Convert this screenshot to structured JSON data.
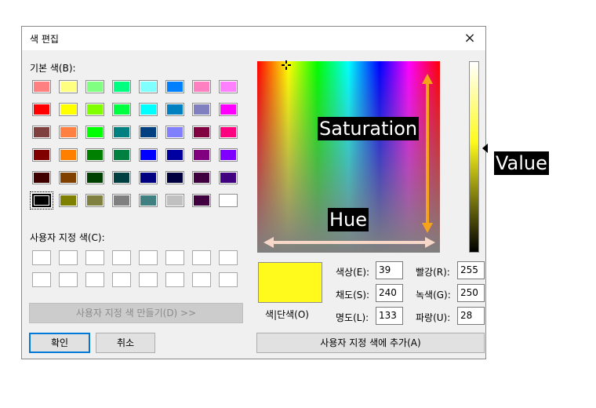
{
  "dialog": {
    "title": "색 편집",
    "close_icon": "×"
  },
  "basic_colors": {
    "label": "기본 색(B):",
    "rows": [
      [
        "#ff8080",
        "#ffff80",
        "#80ff80",
        "#00ff80",
        "#80ffff",
        "#0080ff",
        "#ff80c0",
        "#ff80ff"
      ],
      [
        "#ff0000",
        "#ffff00",
        "#80ff00",
        "#00ff40",
        "#00ffff",
        "#0080c0",
        "#8080c0",
        "#ff00ff"
      ],
      [
        "#804040",
        "#ff8040",
        "#00ff00",
        "#008080",
        "#004080",
        "#8080ff",
        "#800040",
        "#ff0080"
      ],
      [
        "#800000",
        "#ff8000",
        "#008000",
        "#008040",
        "#0000ff",
        "#0000a0",
        "#800080",
        "#8000ff"
      ],
      [
        "#400000",
        "#804000",
        "#004000",
        "#004040",
        "#000080",
        "#000040",
        "#400040",
        "#400080"
      ],
      [
        "#000000",
        "#808000",
        "#808040",
        "#808080",
        "#408080",
        "#c0c0c0",
        "#400040",
        "#ffffff"
      ]
    ],
    "selected_index": [
      5,
      0
    ]
  },
  "custom_colors": {
    "label": "사용자 지정 색(C):",
    "count": 16
  },
  "buttons": {
    "define_custom": "사용자 지정 색 만들기(D) >>",
    "ok": "확인",
    "cancel": "취소",
    "add_custom": "사용자 지정 색에 추가(A)"
  },
  "preview": {
    "label": "색|단색(O)",
    "color": "#fffa1c"
  },
  "fields": {
    "hue": {
      "label": "색상(E):",
      "value": "39"
    },
    "sat": {
      "label": "채도(S):",
      "value": "240"
    },
    "lum": {
      "label": "명도(L):",
      "value": "133"
    },
    "red": {
      "label": "빨강(R):",
      "value": "255"
    },
    "green": {
      "label": "녹색(G):",
      "value": "250"
    },
    "blue": {
      "label": "파랑(U):",
      "value": "28"
    }
  },
  "annotations": {
    "saturation": "Saturation",
    "hue": "Hue",
    "value": "Value",
    "arrow_color_vertical": "#f5a31a",
    "arrow_color_horizontal": "#f6d7c8"
  }
}
